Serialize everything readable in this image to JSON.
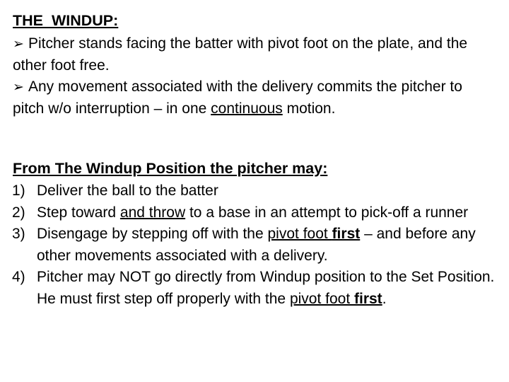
{
  "slide": {
    "background_color": "#ffffff",
    "text_color": "#000000",
    "title": "THE  WINDUP:",
    "bullets": [
      {
        "marker": "➢",
        "marker_name": "arrowhead-bullet",
        "text": "Pitcher stands facing the batter with pivot foot on the plate, and the other foot free."
      },
      {
        "marker": "➢",
        "marker_name": "arrowhead-bullet",
        "text_before": "Any movement associated with the delivery commits the pitcher to pitch w/o interruption – in one ",
        "text_underlined": "continuous",
        "text_after": " motion."
      }
    ],
    "section_heading": "From The Windup Position the pitcher may:",
    "numbered_items": [
      {
        "number": "1)",
        "part1": "Deliver the ball to the batter",
        "underlined": "",
        "bold_underlined": "",
        "part2": ""
      },
      {
        "number": "2)",
        "part1": "Step toward ",
        "underlined": "and throw",
        "bold_underlined": "",
        "part2": " to a base in an attempt to pick-off a runner"
      },
      {
        "number": "3)",
        "part1": "Disengage by stepping off with the ",
        "underlined": "pivot foot ",
        "bold_underlined": "first",
        "part2": " – and before any other movements associated with a delivery."
      },
      {
        "number": "4)",
        "part1": "Pitcher may NOT go directly from Windup position to the Set Position. He must first step off properly with the ",
        "underlined": "pivot foot ",
        "bold_underlined": "first",
        "part2": "."
      }
    ]
  }
}
